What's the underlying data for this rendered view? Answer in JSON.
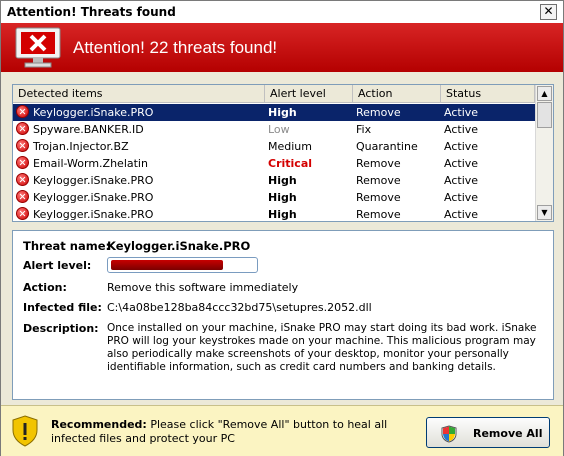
{
  "window": {
    "title": "Attention! Threats found",
    "close_glyph": "✕"
  },
  "banner": {
    "text": "Attention! 22 threats found!",
    "icon": "monitor-error-icon"
  },
  "table": {
    "headers": [
      "Detected items",
      "Alert level",
      "Action",
      "Status"
    ],
    "rows": [
      {
        "name": "Keylogger.iSnake.PRO",
        "level": "High",
        "action": "Remove",
        "status": "Active"
      },
      {
        "name": "Spyware.BANKER.ID",
        "level": "Low",
        "action": "Fix",
        "status": "Active"
      },
      {
        "name": "Trojan.Injector.BZ",
        "level": "Medium",
        "action": "Quarantine",
        "status": "Active"
      },
      {
        "name": "Email-Worm.Zhelatin",
        "level": "Critical",
        "action": "Remove",
        "status": "Active"
      },
      {
        "name": "Keylogger.iSnake.PRO",
        "level": "High",
        "action": "Remove",
        "status": "Active"
      },
      {
        "name": "Keylogger.iSnake.PRO",
        "level": "High",
        "action": "Remove",
        "status": "Active"
      },
      {
        "name": "Keylogger.iSnake.PRO",
        "level": "High",
        "action": "Remove",
        "status": "Active"
      }
    ]
  },
  "details": {
    "threat_name_label": "Threat name:",
    "threat_name": "Keylogger.iSnake.PRO",
    "alert_level_label": "Alert level:",
    "alert_level_fraction": 0.78,
    "action_label": "Action:",
    "action": "Remove this software immediately",
    "infected_file_label": "Infected file:",
    "infected_file": "C:\\4a08be128ba84ccc32bd75\\setupres.2052.dll",
    "description_label": "Description:",
    "description": "Once installed on your machine, iSnake PRO may start doing its bad work. iSnake PRO will log your keystrokes made on your machine. This malicious program may also periodically make screenshots of your desktop, monitor your personally identifiable information, such as credit card numbers and banking details."
  },
  "footer": {
    "recommended_label": "Recommended:",
    "recommended_text": "Please click \"Remove All\" button to heal all infected files and protect your PC",
    "remove_all_label": "Remove All"
  },
  "colors": {
    "banner_red": "#c80000",
    "selection": "#0a246a",
    "critical": "#d40000"
  }
}
